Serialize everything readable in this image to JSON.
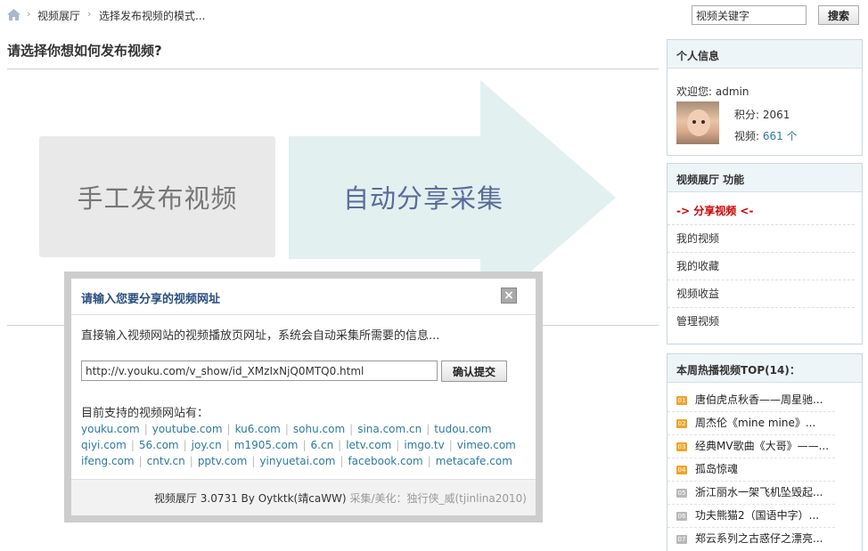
{
  "breadcrumb": {
    "items": [
      "视频展厅",
      "选择发布视频的模式..."
    ],
    "separator": "›"
  },
  "search": {
    "value": "视频关键字",
    "button_label": "搜索"
  },
  "main": {
    "title": "请选择你想如何发布视频?",
    "manual_label": "手工发布视频",
    "auto_label": "自动分享采集"
  },
  "dialog": {
    "title": "请输入您要分享的视频网址",
    "close_label": "×",
    "description": "直接输入视频网站的视频播放页网址，系统会自动采集所需要的信息...",
    "url_value": "http://v.youku.com/v_show/id_XMzIxNjQ0MTQ0.html",
    "submit_label": "确认提交",
    "sites_title": "目前支持的视频网站有：",
    "site_rows": [
      [
        "youku.com",
        "youtube.com",
        "ku6.com",
        "sohu.com",
        "sina.com.cn",
        "tudou.com"
      ],
      [
        "qiyi.com",
        "56.com",
        "joy.cn",
        "m1905.com",
        "6.cn",
        "letv.com",
        "imgo.tv",
        "vimeo.com"
      ],
      [
        "ifeng.com",
        "cntv.cn",
        "pptv.com",
        "yinyuetai.com",
        "facebook.com",
        "metacafe.com"
      ]
    ],
    "footer_main": "视频展厅 3.0731 By Oytktk(靖саWW)",
    "footer_credit": "采集/美化：独行侠_威(tjinlina2010)"
  },
  "profile": {
    "header": "个人信息",
    "welcome": "欢迎您: admin",
    "points": "积分: 2061",
    "videos_label": "视频:",
    "videos_value": "661 个"
  },
  "functions": {
    "header": "视频展厅 功能",
    "items": [
      "-> 分享视频 <-",
      "我的视频",
      "我的收藏",
      "视频收益",
      "管理视频"
    ]
  },
  "hot": {
    "header": "本周热播视频TOP(14)：",
    "items": [
      {
        "rank": "01",
        "title": "唐伯虎点秋香——周星驰..."
      },
      {
        "rank": "02",
        "title": "周杰伦《mine mine》..."
      },
      {
        "rank": "03",
        "title": "经典MV歌曲《大哥》——..."
      },
      {
        "rank": "04",
        "title": "孤岛惊魂"
      },
      {
        "rank": "05",
        "title": "浙江丽水一架飞机坠毁起..."
      },
      {
        "rank": "06",
        "title": "功夫熊猫2（国语中字）..."
      },
      {
        "rank": "07",
        "title": "郑云系列之古惑仔之漂亮..."
      }
    ]
  },
  "colors": {
    "link": "#2d7a9e",
    "dialog_title": "#2b4f81",
    "share_item": "#cc0000",
    "arrow": "#e2f0f0",
    "hot_badge": "#f0a32b"
  }
}
